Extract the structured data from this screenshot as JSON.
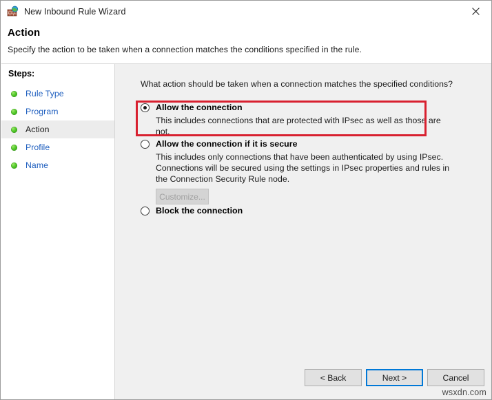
{
  "window": {
    "title": "New Inbound Rule Wizard",
    "icon": "firewall-globe-icon",
    "close_label": "✕"
  },
  "header": {
    "title": "Action",
    "subtitle": "Specify the action to be taken when a connection matches the conditions specified in the rule."
  },
  "sidebar": {
    "heading": "Steps:",
    "items": [
      {
        "label": "Rule Type",
        "current": false
      },
      {
        "label": "Program",
        "current": false
      },
      {
        "label": "Action",
        "current": true
      },
      {
        "label": "Profile",
        "current": false
      },
      {
        "label": "Name",
        "current": false
      }
    ]
  },
  "main": {
    "question": "What action should be taken when a connection matches the specified conditions?",
    "options": [
      {
        "id": "allow",
        "title": "Allow the connection",
        "description": "This includes connections that are protected with IPsec as well as those are not.",
        "selected": true,
        "highlighted": true
      },
      {
        "id": "allow-if-secure",
        "title": "Allow the connection if it is secure",
        "description": "This includes only connections that have been authenticated by using IPsec.  Connections will be secured using the settings in IPsec properties and rules in the Connection Security Rule node.",
        "selected": false,
        "highlighted": false
      },
      {
        "id": "block",
        "title": "Block the connection",
        "description": "",
        "selected": false,
        "highlighted": false
      }
    ],
    "customize_label": "Customize..."
  },
  "footer": {
    "back_label": "< Back",
    "next_label": "Next >",
    "cancel_label": "Cancel"
  },
  "watermark": "wsxdn.com",
  "colors": {
    "accent_focus": "#0078d7",
    "annotation_red": "#d8202f",
    "step_link": "#1f5fbf",
    "pane_background": "#f0f0f0"
  }
}
